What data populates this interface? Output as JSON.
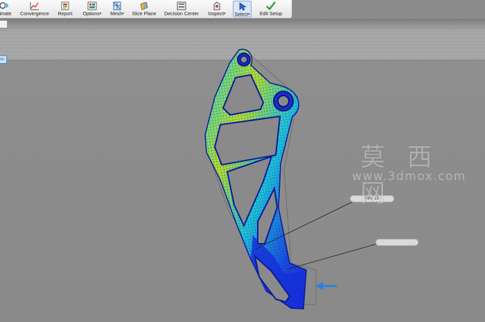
{
  "toolbar": {
    "buttons": [
      {
        "id": "animate",
        "label": "imate",
        "icon": "animate-icon"
      },
      {
        "id": "convergence",
        "label": "Convergence",
        "icon": "convergence-chart-icon"
      },
      {
        "id": "report",
        "label": "Report",
        "icon": "report-icon"
      },
      {
        "id": "options",
        "label": "Options",
        "icon": "options-icon",
        "dropdown": true
      },
      {
        "id": "mesh",
        "label": "Mesh",
        "icon": "mesh-icon",
        "dropdown": true
      },
      {
        "id": "slice-plane",
        "label": "Slice Plane",
        "icon": "slice-plane-icon"
      },
      {
        "id": "decision-center",
        "label": "Decision Center",
        "icon": "decision-center-icon"
      },
      {
        "id": "inspect",
        "label": "Inspect",
        "icon": "inspect-icon",
        "dropdown": true
      },
      {
        "id": "select",
        "label": "Select",
        "icon": "select-cursor-icon",
        "dropdown": true,
        "active": true
      },
      {
        "id": "edit-setup",
        "label": "Edit Setup",
        "icon": "checkmark-icon"
      }
    ]
  },
  "browser_tab": {
    "label": "ss"
  },
  "viewport": {
    "probe_label_1": "Min: 15",
    "probe_label_2": "",
    "load_arrow_icon": "load-arrow-icon"
  },
  "watermark": {
    "chinese": "莫 西 网",
    "url": "www.3dmox.com"
  },
  "colors": {
    "viewport_bg": "#8b8b8b",
    "ribbon_bg": "#f0f0f0",
    "stress_low": "#1428d8",
    "stress_high": "#e8e61e",
    "load_arrow": "#2a7fe0",
    "select_active": "#d9e6f5"
  }
}
